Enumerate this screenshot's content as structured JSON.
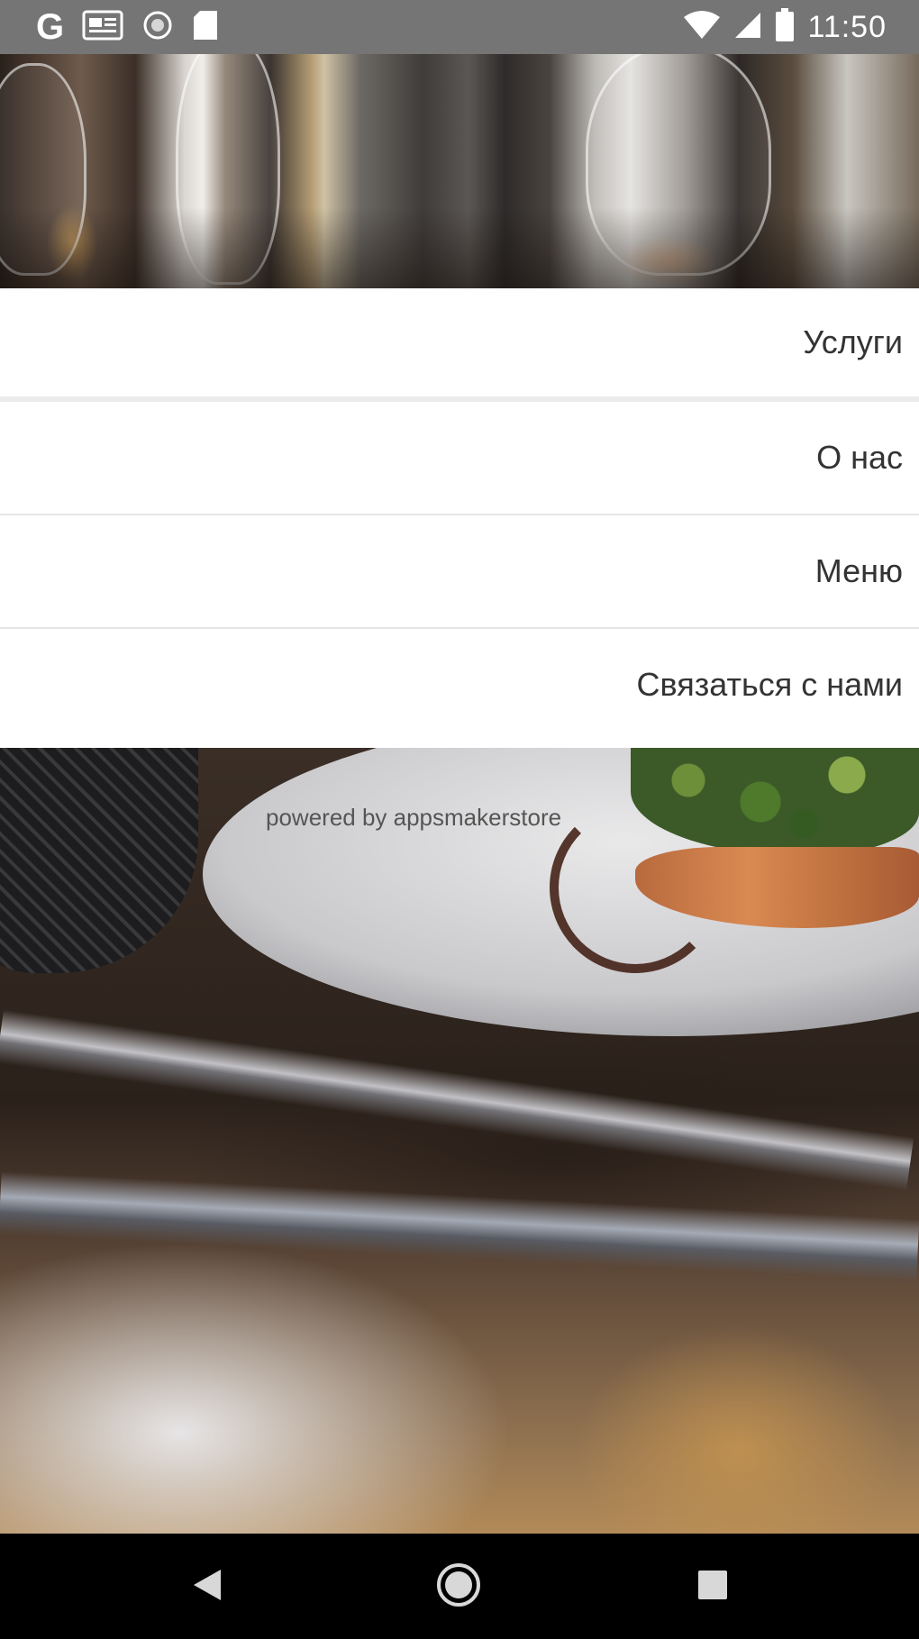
{
  "status_bar": {
    "time": "11:50",
    "left_icons": [
      "google-icon",
      "image-notification-icon",
      "circle-notification-icon",
      "sd-card-icon"
    ],
    "right_icons": [
      "wifi-icon",
      "cellular-signal-icon",
      "battery-icon"
    ],
    "google_glyph": "G"
  },
  "menu": {
    "items": [
      {
        "label": "Услуги"
      },
      {
        "label": "О нас"
      },
      {
        "label": "Меню"
      },
      {
        "label": "Связаться с нами"
      }
    ]
  },
  "footer": {
    "powered_by": "powered by appsmakerstore"
  },
  "nav_bar": {
    "buttons": [
      "back-button",
      "home-button",
      "recents-button"
    ]
  }
}
